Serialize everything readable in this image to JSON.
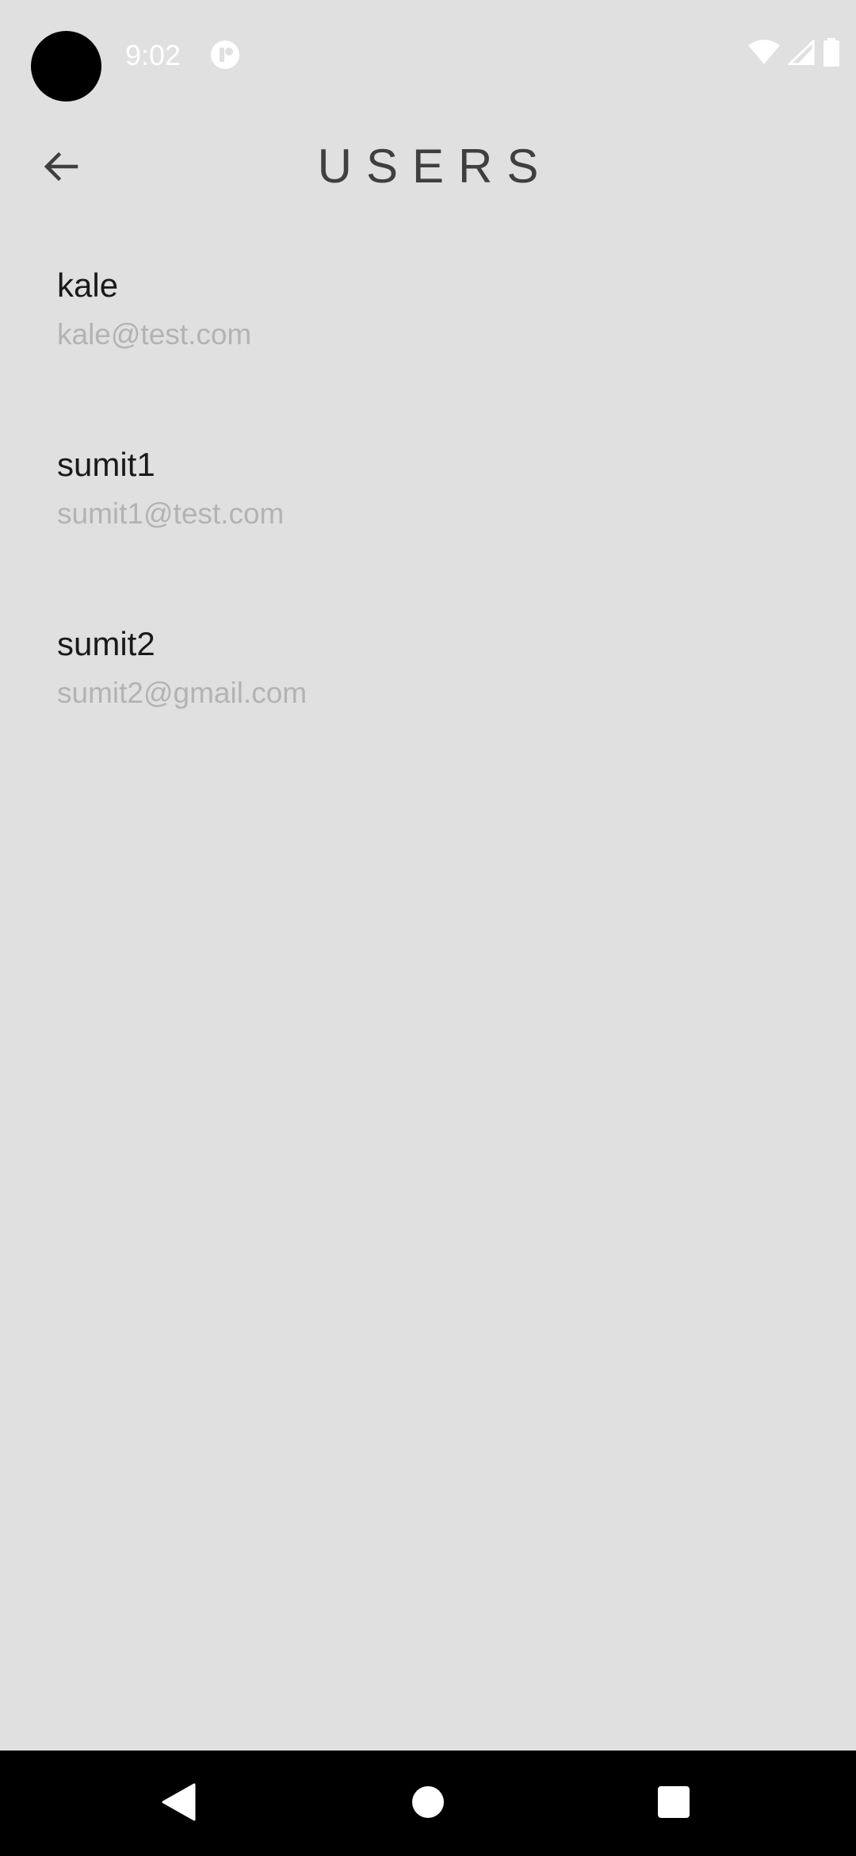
{
  "status_bar": {
    "time": "9:02",
    "icons": [
      "camera-cutout",
      "app-notification-icon",
      "wifi-icon",
      "cellular-signal-icon",
      "battery-icon"
    ]
  },
  "app_bar": {
    "back_icon": "arrow-left-icon",
    "title": "USERS"
  },
  "users": [
    {
      "name": "kale",
      "email": "kale@test.com"
    },
    {
      "name": "sumit1",
      "email": "sumit1@test.com"
    },
    {
      "name": "sumit2",
      "email": "sumit2@gmail.com"
    }
  ],
  "nav_bar": {
    "buttons": [
      "back-triangle-icon",
      "home-circle-icon",
      "recents-square-icon"
    ]
  },
  "colors": {
    "background": "#e0e0e0",
    "title_text": "#3f3f3f",
    "name_text": "#1a1a1a",
    "email_text": "#b3b3b3",
    "nav_bar": "#000000"
  }
}
